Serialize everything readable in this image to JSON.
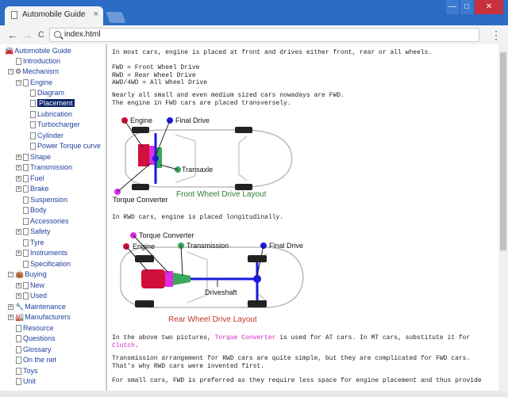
{
  "browser": {
    "tab_title": "Automobile Guide",
    "tab_close": "×",
    "url": "index.html",
    "back": "←",
    "forward": "→",
    "reload": "C",
    "menu": "⋮",
    "min": "—",
    "max": "□",
    "close": "✕"
  },
  "tree": {
    "root": "Automobile Guide",
    "introduction": "Introduction",
    "mechanism": "Mechanism",
    "engine": "Engine",
    "diagram": "Diagram",
    "placement": "Placement",
    "lubrication": "Lubrication",
    "turbocharger": "Turbocharger",
    "cylinder": "Cylinder",
    "power_torque_curve": "Power Torque curve",
    "shape": "Shape",
    "transmission": "Transmission",
    "fuel": "Fuel",
    "brake": "Brake",
    "suspension": "Suspension",
    "body": "Body",
    "accessories": "Accessories",
    "safety": "Safety",
    "tyre": "Tyre",
    "instruments": "Instruments",
    "specification": "Specification",
    "buying": "Buying",
    "new": "New",
    "used": "Used",
    "maintenance": "Maintenance",
    "manufacturers": "Manufacturers",
    "resource": "Resource",
    "questions": "Questions",
    "glossary": "Glossary",
    "on_the_net": "On the net",
    "toys": "Toys",
    "unit": "Unit"
  },
  "content": {
    "p1": "In most cars, engine is placed at front and drives either front, rear or all wheels.",
    "p2": "FWD = Front Wheel Drive\nRWD = Rear Wheel Drive\nAWD/4WD = All Wheel Drive",
    "p3": "Nearly all small and even medium sized cars nowadays are FWD.\nThe engine in FWD cars are placed transversely.",
    "fwd": {
      "engine": "Engine",
      "final_drive": "Final Drive",
      "transaxle": "Transaxle",
      "torque_converter": "Torque Converter",
      "caption": "Front Wheel Drive Layout"
    },
    "p4": "In RWD cars, engine is placed longitudinally.",
    "rwd": {
      "torque_converter": "Torque Converter",
      "engine": "Engine",
      "transmission": "Transmission",
      "final_drive": "Final Drive",
      "driveshaft": "Driveshaft",
      "caption": "Rear Wheel Drive Layout"
    },
    "p5_a": "In the above two pictures, ",
    "p5_link1": "Torque Converter",
    "p5_b": " is used for AT cars. In MT cars, substitute it for ",
    "p5_link2": "Clutch",
    "p5_c": ".",
    "p6": "Transmission arrangement for RWD cars are quite simple, but they are complicated for FWD cars.\nThat's why RWD cars were invented first.",
    "p7": "For small cars, FWD is preferred as they require less space for engine placement and thus provide"
  },
  "colors": {
    "engine": "#d0103a",
    "final_drive": "#1a1adc",
    "transaxle": "#3aa85a",
    "torque_converter": "#e02ce0",
    "fwd_caption": "#2e7d32",
    "rwd_caption": "#c0392b"
  }
}
